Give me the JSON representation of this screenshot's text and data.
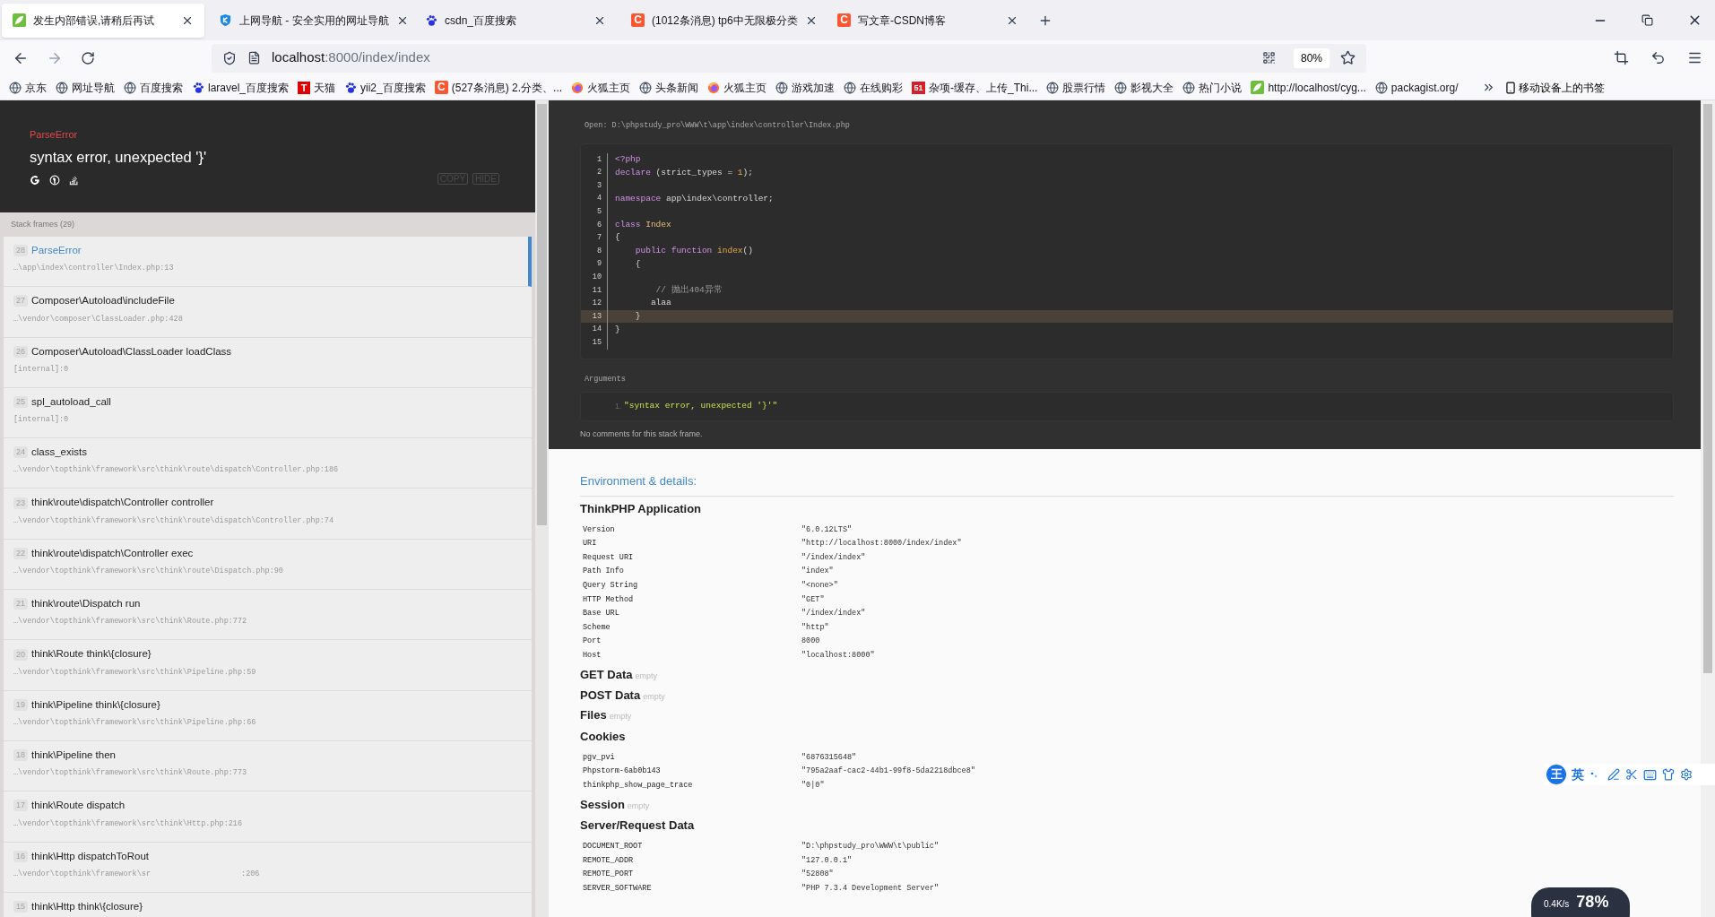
{
  "tabs": [
    {
      "title": "发生内部错误,请稍后再试",
      "selected": true
    },
    {
      "title": "上网导航 - 安全实用的网址导航",
      "selected": false
    },
    {
      "title": "csdn_百度搜索",
      "selected": false
    },
    {
      "title": "(1012条消息) tp6中无限极分类",
      "icon_text": "C",
      "selected": false
    },
    {
      "title": "写文章-CSDN博客",
      "icon_text": "C",
      "selected": false
    }
  ],
  "address": {
    "host": "localhost",
    "path": ":8000/index/index",
    "zoom": "80%"
  },
  "bookmarks": [
    {
      "label": "京东"
    },
    {
      "label": "网址导航"
    },
    {
      "label": "百度搜索"
    },
    {
      "label": "laravel_百度搜索"
    },
    {
      "label": "天猫",
      "icon_text": "T"
    },
    {
      "label": "yii2_百度搜索"
    },
    {
      "label": "(527条消息) 2.分类、...",
      "icon_text": "C"
    },
    {
      "label": "火狐主页"
    },
    {
      "label": "头条新闻"
    },
    {
      "label": "火狐主页"
    },
    {
      "label": "游戏加速"
    },
    {
      "label": "在线购彩"
    },
    {
      "label": "杂项-缓存、上传_Thi...",
      "icon_text": "51"
    },
    {
      "label": "股票行情"
    },
    {
      "label": "影视大全"
    },
    {
      "label": "热门小说"
    },
    {
      "label": "http://localhost/cyg..."
    },
    {
      "label": "packagist.org/"
    }
  ],
  "mobile_bookmarks": "移动设备上的书签",
  "error": {
    "type": "ParseError",
    "message": "syntax error, unexpected '}'",
    "buttons": [
      "COPY",
      "HIDE"
    ]
  },
  "stack_label": "Stack frames (29)",
  "frames": [
    {
      "number": "28",
      "title": "ParseError",
      "file": "…\\app\\index\\controller\\Index.php:13",
      "selected": true
    },
    {
      "number": "27",
      "title": "Composer\\Autoload\\includeFile",
      "file": "…\\vendor\\composer\\ClassLoader.php:428",
      "selected": false
    },
    {
      "number": "26",
      "title": "Composer\\Autoload\\ClassLoader loadClass",
      "file": "[internal]:0",
      "selected": false
    },
    {
      "number": "25",
      "title": "spl_autoload_call",
      "file": "[internal]:0",
      "selected": false
    },
    {
      "number": "24",
      "title": "class_exists",
      "file": "…\\vendor\\topthink\\framework\\src\\think\\route\\dispatch\\Controller.php:186",
      "selected": false
    },
    {
      "number": "23",
      "title": "think\\route\\dispatch\\Controller controller",
      "file": "…\\vendor\\topthink\\framework\\src\\think\\route\\dispatch\\Controller.php:74",
      "selected": false
    },
    {
      "number": "22",
      "title": "think\\route\\dispatch\\Controller exec",
      "file": "…\\vendor\\topthink\\framework\\src\\think\\route\\Dispatch.php:90",
      "selected": false
    },
    {
      "number": "21",
      "title": "think\\route\\Dispatch run",
      "file": "…\\vendor\\topthink\\framework\\src\\think\\Route.php:772",
      "selected": false
    },
    {
      "number": "20",
      "title": "think\\Route think\\{closure}",
      "file": "…\\vendor\\topthink\\framework\\src\\think\\Pipeline.php:59",
      "selected": false
    },
    {
      "number": "19",
      "title": "think\\Pipeline think\\{closure}",
      "file": "…\\vendor\\topthink\\framework\\src\\think\\Pipeline.php:66",
      "selected": false
    },
    {
      "number": "18",
      "title": "think\\Pipeline then",
      "file": "…\\vendor\\topthink\\framework\\src\\think\\Route.php:773",
      "selected": false
    },
    {
      "number": "17",
      "title": "think\\Route dispatch",
      "file": "…\\vendor\\topthink\\framework\\src\\think\\Http.php:216",
      "selected": false
    },
    {
      "number": "16",
      "title": "think\\Http dispatchToRout",
      "file": "…\\vendor\\topthink\\framework\\sr",
      "file_tail": ":206",
      "selected": false
    },
    {
      "number": "15",
      "title": "think\\Http think\\{closure}",
      "selected": false
    }
  ],
  "source": {
    "open": "Open: D:\\phpstudy_pro\\WWW\\t\\app\\index\\controller\\Index.php",
    "lines": [
      {
        "number": "1",
        "selected": false,
        "tokens": [
          {
            "kind": "keyword",
            "text": "<?php"
          }
        ]
      },
      {
        "number": "2",
        "selected": false,
        "tokens": [
          {
            "kind": "keyword",
            "text": "declare"
          },
          {
            "kind": "plain",
            "text": " (strict_types = "
          },
          {
            "kind": "number",
            "text": "1"
          },
          {
            "kind": "plain",
            "text": ");"
          }
        ]
      },
      {
        "number": "3",
        "selected": false
      },
      {
        "number": "4",
        "selected": false,
        "tokens": [
          {
            "kind": "keyword",
            "text": "namespace"
          },
          {
            "kind": "plain",
            "text": " app\\index\\controller;"
          }
        ]
      },
      {
        "number": "5",
        "selected": false
      },
      {
        "number": "6",
        "selected": false,
        "tokens": [
          {
            "kind": "keyword",
            "text": "class "
          },
          {
            "kind": "name",
            "text": "Index"
          }
        ]
      },
      {
        "number": "7",
        "selected": false,
        "tokens": [
          {
            "kind": "plain",
            "text": "{"
          }
        ]
      },
      {
        "number": "8",
        "selected": false,
        "tokens": [
          {
            "kind": "keyword",
            "text": "    public function "
          },
          {
            "kind": "function",
            "text": "index"
          },
          {
            "kind": "plain",
            "text": "()"
          }
        ]
      },
      {
        "number": "9",
        "selected": false,
        "tokens": [
          {
            "kind": "plain",
            "text": "    {"
          }
        ]
      },
      {
        "number": "10",
        "selected": false
      },
      {
        "number": "11",
        "selected": false,
        "tokens": [
          {
            "kind": "comment",
            "text": "        // 抛出404异常"
          }
        ]
      },
      {
        "number": "12",
        "selected": false,
        "tokens": [
          {
            "kind": "plain",
            "text": "       alaa"
          }
        ]
      },
      {
        "number": "13",
        "selected": true,
        "tokens": [
          {
            "kind": "plain",
            "text": "    }"
          }
        ]
      },
      {
        "number": "14",
        "selected": false,
        "tokens": [
          {
            "kind": "plain",
            "text": "}"
          }
        ]
      },
      {
        "number": "15",
        "selected": false
      }
    ],
    "arguments_label": "Arguments",
    "arguments": [
      {
        "number": "1.",
        "value": "\"syntax error, unexpected '}'\""
      }
    ],
    "comments": "No comments for this stack frame."
  },
  "environment": {
    "heading": "Environment & details:",
    "sections": [
      {
        "title": "ThinkPHP Application",
        "rows": [
          [
            "Version",
            "\"6.0.12LTS\""
          ],
          [
            "URI",
            "\"http://localhost:8000/index/index\""
          ],
          [
            "Request URI",
            "\"/index/index\""
          ],
          [
            "Path Info",
            "\"index\""
          ],
          [
            "Query String",
            "\"<none>\""
          ],
          [
            "HTTP Method",
            "\"GET\""
          ],
          [
            "Base URL",
            "\"/index/index\""
          ],
          [
            "Scheme",
            "\"http\""
          ],
          [
            "Port",
            "8000"
          ],
          [
            "Host",
            "\"localhost:8000\""
          ]
        ]
      },
      {
        "title": "GET Data",
        "empty": "empty"
      },
      {
        "title": "POST Data",
        "empty": "empty"
      },
      {
        "title": "Files",
        "empty": "empty"
      },
      {
        "title": "Cookies",
        "rows": [
          [
            "pgv_pvi",
            "\"6876315648\""
          ],
          [
            "Phpstorm-6ab0b143",
            "\"795a2aaf-cac2-44b1-99f8-5da2218dbce8\""
          ],
          [
            "thinkphp_show_page_trace",
            "\"0|0\""
          ]
        ]
      },
      {
        "title": "Session",
        "empty": "empty"
      },
      {
        "title": "Server/Request Data",
        "rows": [
          [
            "DOCUMENT_ROOT",
            "\"D:\\phpstudy_pro\\WWW\\t\\public\""
          ],
          [
            "REMOTE_ADDR",
            "\"127.0.0.1\""
          ],
          [
            "REMOTE_PORT",
            "\"52808\""
          ],
          [
            "SERVER_SOFTWARE",
            "\"PHP 7.3.4 Development Server\""
          ]
        ]
      }
    ]
  },
  "ime": {
    "logo": "王",
    "mode": "英"
  },
  "net_widget": {
    "speed": "0.4K/s",
    "percent": "78%"
  }
}
